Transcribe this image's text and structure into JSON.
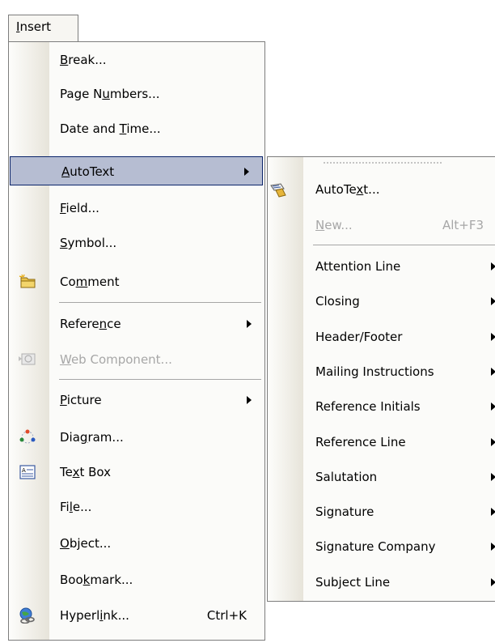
{
  "menu": {
    "title": "Insert",
    "title_mnemonic": "I",
    "items": [
      {
        "pre": "",
        "u": "B",
        "post": "reak...",
        "shortcut": "",
        "submenu": false,
        "disabled": false,
        "highlighted": false,
        "icon": ""
      },
      {
        "pre": "Page N",
        "u": "u",
        "post": "mbers...",
        "shortcut": "",
        "submenu": false,
        "disabled": false,
        "highlighted": false,
        "icon": ""
      },
      {
        "pre": "Date and ",
        "u": "T",
        "post": "ime...",
        "shortcut": "",
        "submenu": false,
        "disabled": false,
        "highlighted": false,
        "icon": ""
      },
      {
        "pre": "",
        "u": "A",
        "post": "utoText",
        "shortcut": "",
        "submenu": true,
        "disabled": false,
        "highlighted": true,
        "icon": ""
      },
      {
        "pre": "",
        "u": "F",
        "post": "ield...",
        "shortcut": "",
        "submenu": false,
        "disabled": false,
        "highlighted": false,
        "icon": ""
      },
      {
        "pre": "",
        "u": "S",
        "post": "ymbol...",
        "shortcut": "",
        "submenu": false,
        "disabled": false,
        "highlighted": false,
        "icon": ""
      },
      {
        "pre": "Co",
        "u": "m",
        "post": "ment",
        "shortcut": "",
        "submenu": false,
        "disabled": false,
        "highlighted": false,
        "icon": "comment-icon"
      },
      {
        "pre": "Refere",
        "u": "n",
        "post": "ce",
        "shortcut": "",
        "submenu": true,
        "disabled": false,
        "highlighted": false,
        "icon": ""
      },
      {
        "pre": "",
        "u": "W",
        "post": "eb Component...",
        "shortcut": "",
        "submenu": false,
        "disabled": true,
        "highlighted": false,
        "icon": "web-component-icon"
      },
      {
        "pre": "",
        "u": "P",
        "post": "icture",
        "shortcut": "",
        "submenu": true,
        "disabled": false,
        "highlighted": false,
        "icon": ""
      },
      {
        "pre": "Dia",
        "u": "g",
        "post": "ram...",
        "shortcut": "",
        "submenu": false,
        "disabled": false,
        "highlighted": false,
        "icon": "diagram-icon"
      },
      {
        "pre": "Te",
        "u": "x",
        "post": "t Box",
        "shortcut": "",
        "submenu": false,
        "disabled": false,
        "highlighted": false,
        "icon": "text-box-icon"
      },
      {
        "pre": "Fi",
        "u": "l",
        "post": "e...",
        "shortcut": "",
        "submenu": false,
        "disabled": false,
        "highlighted": false,
        "icon": ""
      },
      {
        "pre": "",
        "u": "O",
        "post": "bject...",
        "shortcut": "",
        "submenu": false,
        "disabled": false,
        "highlighted": false,
        "icon": ""
      },
      {
        "pre": "Boo",
        "u": "k",
        "post": "mark...",
        "shortcut": "",
        "submenu": false,
        "disabled": false,
        "highlighted": false,
        "icon": ""
      },
      {
        "pre": "Hyperl",
        "u": "i",
        "post": "nk...",
        "shortcut": "Ctrl+K",
        "submenu": false,
        "disabled": false,
        "highlighted": false,
        "icon": "hyperlink-icon"
      }
    ]
  },
  "submenu": {
    "items": [
      {
        "pre": "AutoTe",
        "u": "x",
        "post": "t...",
        "shortcut": "",
        "submenu": false,
        "disabled": false,
        "icon": "autotext-icon"
      },
      {
        "pre": "",
        "u": "N",
        "post": "ew...",
        "shortcut": "Alt+F3",
        "submenu": false,
        "disabled": true,
        "icon": ""
      },
      {
        "pre": "Attention Line",
        "u": "",
        "post": "",
        "shortcut": "",
        "submenu": true,
        "disabled": false,
        "icon": ""
      },
      {
        "pre": "Closing",
        "u": "",
        "post": "",
        "shortcut": "",
        "submenu": true,
        "disabled": false,
        "icon": ""
      },
      {
        "pre": "Header/Footer",
        "u": "",
        "post": "",
        "shortcut": "",
        "submenu": true,
        "disabled": false,
        "icon": ""
      },
      {
        "pre": "Mailing Instructions",
        "u": "",
        "post": "",
        "shortcut": "",
        "submenu": true,
        "disabled": false,
        "icon": ""
      },
      {
        "pre": "Reference Initials",
        "u": "",
        "post": "",
        "shortcut": "",
        "submenu": true,
        "disabled": false,
        "icon": ""
      },
      {
        "pre": "Reference Line",
        "u": "",
        "post": "",
        "shortcut": "",
        "submenu": true,
        "disabled": false,
        "icon": ""
      },
      {
        "pre": "Salutation",
        "u": "",
        "post": "",
        "shortcut": "",
        "submenu": true,
        "disabled": false,
        "icon": ""
      },
      {
        "pre": "Signature",
        "u": "",
        "post": "",
        "shortcut": "",
        "submenu": true,
        "disabled": false,
        "icon": ""
      },
      {
        "pre": "Signature Company",
        "u": "",
        "post": "",
        "shortcut": "",
        "submenu": true,
        "disabled": false,
        "icon": ""
      },
      {
        "pre": "Subject Line",
        "u": "",
        "post": "",
        "shortcut": "",
        "submenu": true,
        "disabled": false,
        "icon": ""
      }
    ]
  },
  "colors": {
    "highlight_bg": "#b6bdd2",
    "highlight_border": "#0a246a",
    "disabled_text": "#a7a7a7",
    "menu_border": "#7d7d7d"
  }
}
